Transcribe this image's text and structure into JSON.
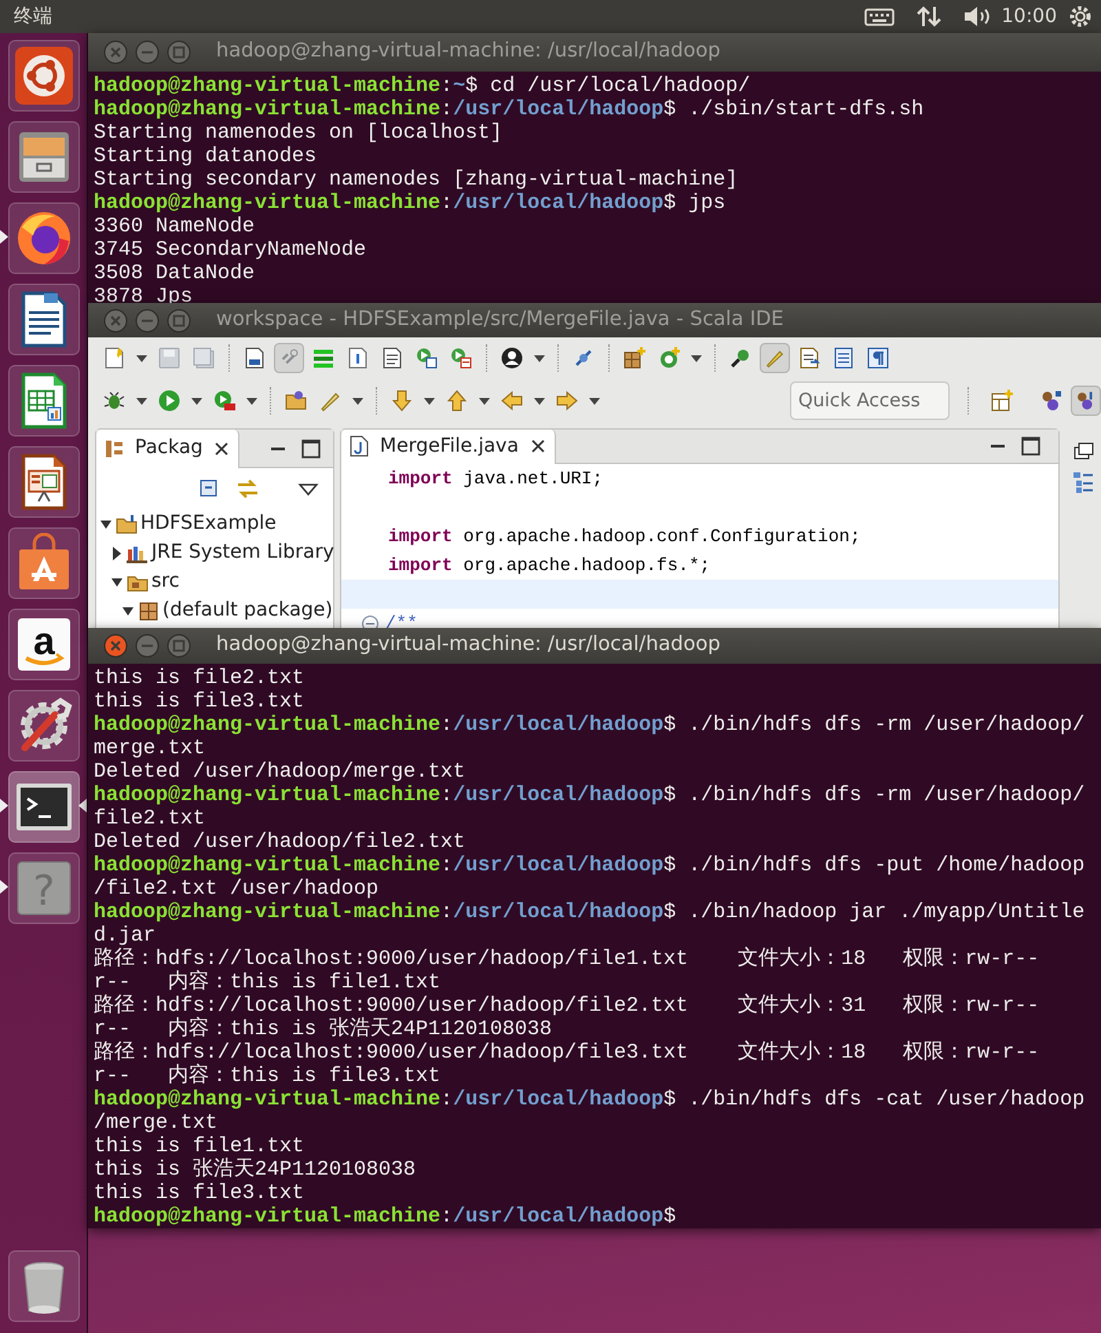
{
  "top_panel": {
    "app_name": "终端",
    "clock": "10:00"
  },
  "launcher": [
    {
      "kind": "dash",
      "running": false,
      "focused": false
    },
    {
      "kind": "files",
      "running": false,
      "focused": false
    },
    {
      "kind": "browser",
      "running": true,
      "focused": false
    },
    {
      "kind": "writer",
      "running": false,
      "focused": false
    },
    {
      "kind": "calc",
      "running": false,
      "focused": false
    },
    {
      "kind": "impress",
      "running": false,
      "focused": false
    },
    {
      "kind": "software",
      "running": false,
      "focused": false
    },
    {
      "kind": "shop",
      "glyph": "a",
      "running": false,
      "focused": false
    },
    {
      "kind": "settings",
      "running": false,
      "focused": false
    },
    {
      "kind": "terminal",
      "running": true,
      "focused": true
    },
    {
      "kind": "help",
      "glyph": "?",
      "running": true,
      "focused": false
    },
    {
      "kind": "trash",
      "running": false,
      "focused": false
    }
  ],
  "windows": [
    {
      "kind": "terminal",
      "title": "hadoop@zhang-virtual-machine: /usr/local/hadoop",
      "active": false,
      "lines": [
        {
          "kind": "prompt",
          "user": "hadoop@zhang-virtual-machine",
          "sep": ":",
          "path": "~",
          "command": "$ cd /usr/local/hadoop/"
        },
        {
          "kind": "prompt",
          "user": "hadoop@zhang-virtual-machine",
          "sep": ":",
          "path": "/usr/local/hadoop",
          "command": "$ ./sbin/start-dfs.sh"
        },
        {
          "kind": "output",
          "text": "Starting namenodes on [localhost]"
        },
        {
          "kind": "output",
          "text": "Starting datanodes"
        },
        {
          "kind": "output",
          "text": "Starting secondary namenodes [zhang-virtual-machine]"
        },
        {
          "kind": "prompt",
          "user": "hadoop@zhang-virtual-machine",
          "sep": ":",
          "path": "/usr/local/hadoop",
          "command": "$ jps"
        },
        {
          "kind": "output",
          "text": "3360 NameNode"
        },
        {
          "kind": "output",
          "text": "3745 SecondaryNameNode"
        },
        {
          "kind": "output",
          "text": "3508 DataNode"
        },
        {
          "kind": "output",
          "text": "3878 Jps"
        }
      ]
    },
    {
      "kind": "ide",
      "title": "workspace - HDFSExample/src/MergeFile.java - Scala IDE",
      "active": false,
      "quick_access": {
        "placeholder": "Quick Access"
      },
      "package_explorer": {
        "tab": "Packag",
        "tree": [
          {
            "kind": "project",
            "label": "HDFSExample",
            "expanded": true,
            "children": [
              {
                "kind": "library",
                "label": "JRE System Library",
                "expanded": false
              },
              {
                "kind": "source",
                "label": "src",
                "expanded": true,
                "children": [
                  {
                    "kind": "package",
                    "label": "(default package)",
                    "expanded": true
                  }
                ]
              }
            ]
          }
        ]
      },
      "editor": {
        "tab": "MergeFile.java",
        "lines": [
          {
            "kind": "code",
            "keyword": "import",
            "text": " java.net.URI;"
          },
          {
            "kind": "blank"
          },
          {
            "kind": "code",
            "keyword": "import",
            "text": " org.apache.hadoop.conf.Configuration;"
          },
          {
            "kind": "code",
            "keyword": "import",
            "text": " org.apache.hadoop.fs.*;"
          },
          {
            "kind": "current_line"
          },
          {
            "kind": "comment",
            "text": "/**"
          }
        ]
      }
    },
    {
      "kind": "terminal",
      "title": "hadoop@zhang-virtual-machine: /usr/local/hadoop",
      "active": true,
      "lines": [
        {
          "kind": "output",
          "text": "this is file2.txt"
        },
        {
          "kind": "output",
          "text": "this is file3.txt"
        },
        {
          "kind": "prompt",
          "user": "hadoop@zhang-virtual-machine",
          "sep": ":",
          "path": "/usr/local/hadoop",
          "command": "$ ./bin/hdfs dfs -rm /user/hadoop/"
        },
        {
          "kind": "output",
          "text": "merge.txt"
        },
        {
          "kind": "output",
          "text": "Deleted /user/hadoop/merge.txt"
        },
        {
          "kind": "prompt",
          "user": "hadoop@zhang-virtual-machine",
          "sep": ":",
          "path": "/usr/local/hadoop",
          "command": "$ ./bin/hdfs dfs -rm /user/hadoop/"
        },
        {
          "kind": "output",
          "text": "file2.txt"
        },
        {
          "kind": "output",
          "text": "Deleted /user/hadoop/file2.txt"
        },
        {
          "kind": "prompt",
          "user": "hadoop@zhang-virtual-machine",
          "sep": ":",
          "path": "/usr/local/hadoop",
          "command": "$ ./bin/hdfs dfs -put /home/hadoop"
        },
        {
          "kind": "output",
          "text": "/file2.txt /user/hadoop"
        },
        {
          "kind": "prompt",
          "user": "hadoop@zhang-virtual-machine",
          "sep": ":",
          "path": "/usr/local/hadoop",
          "command": "$ ./bin/hadoop jar ./myapp/Untitle"
        },
        {
          "kind": "output",
          "text": "d.jar"
        },
        {
          "kind": "output",
          "text": "路径：hdfs://localhost:9000/user/hadoop/file1.txt    文件大小：18   权限：rw-r--"
        },
        {
          "kind": "output",
          "text": "r--   内容：this is file1.txt"
        },
        {
          "kind": "output",
          "text": "路径：hdfs://localhost:9000/user/hadoop/file2.txt    文件大小：31   权限：rw-r--"
        },
        {
          "kind": "output",
          "text": "r--   内容：this is 张浩天24P1120108038"
        },
        {
          "kind": "output",
          "text": "路径：hdfs://localhost:9000/user/hadoop/file3.txt    文件大小：18   权限：rw-r--"
        },
        {
          "kind": "output",
          "text": "r--   内容：this is file3.txt"
        },
        {
          "kind": "prompt",
          "user": "hadoop@zhang-virtual-machine",
          "sep": ":",
          "path": "/usr/local/hadoop",
          "command": "$ ./bin/hdfs dfs -cat /user/hadoop"
        },
        {
          "kind": "output",
          "text": "/merge.txt"
        },
        {
          "kind": "output",
          "text": "this is file1.txt"
        },
        {
          "kind": "output",
          "text": "this is 张浩天24P1120108038"
        },
        {
          "kind": "output",
          "text": "this is file3.txt"
        },
        {
          "kind": "prompt",
          "user": "hadoop@zhang-virtual-machine",
          "sep": ":",
          "path": "/usr/local/hadoop",
          "command": "$"
        }
      ]
    }
  ]
}
